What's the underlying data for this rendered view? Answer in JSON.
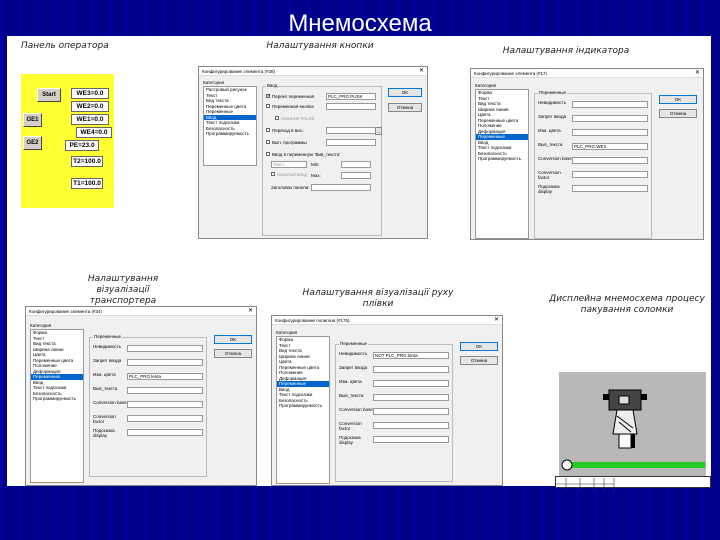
{
  "slide": {
    "title": "Мнемосхема",
    "background_color": "#00008b"
  },
  "captions": {
    "operator_panel": "Панель оператора",
    "button_setup": "Налаштування кнопки",
    "indicator_setup": "Налаштування індикатора",
    "conveyor_viz_line1": "Налаштування",
    "conveyor_viz_line2": "візуалізації транспортера",
    "film_viz": "Налаштування візуалізації руху плівки",
    "display_line1": "Дисплейна мнемосхема процесу",
    "display_line2": "пакування соломки"
  },
  "operator_panel": {
    "color": "#ffff33",
    "start_label": "Start",
    "ge1_label": "GE1",
    "ge2_label": "GE2",
    "we3": "WE3=0.0",
    "we2": "WE2=0.0",
    "we1": "WE1=0.0",
    "we4": "WE4=0.0",
    "pe": "PE=23.0",
    "t2": "T2=100.0",
    "t1": "T1=100.0"
  },
  "dialog_button": {
    "title": "Конфигурирование элемента (#38)",
    "category_label": "Категория",
    "categories": [
      "Растровый рисунок",
      "Текст",
      "Вид текста",
      "Переменные цвета",
      "Переменные",
      "Ввод",
      "Текст подсказки",
      "Безопасность",
      "Программируемость"
    ],
    "selected_index": 5,
    "group_label": "Ввод",
    "toggle_var_label": "Перекл переменная",
    "toggle_var_value": "PLC_PRG.PUSK",
    "toggle_var_checked": true,
    "button_var_label": "Переменная-кнопка",
    "push_false_label": "Нажатие FALSE",
    "goto_label": "Переход в виз.:",
    "run_program_label": "Вып. программы",
    "input_var_label": "Ввод в переменную 'Вив_текста'",
    "text_label": "Текст",
    "min_label": "Min:",
    "max_label": "Max:",
    "hidden_input_label": "Скрытый ввод",
    "dialog_title_label": "Заголовок панели:",
    "ok_label": "OK",
    "cancel_label": "Отмена"
  },
  "dialog_indicator": {
    "title": "Конфигурирование элемента (#17)",
    "category_label": "Категория",
    "categories": [
      "Форма",
      "Текст",
      "Вид текста",
      "Ширина линии",
      "Цвета",
      "Переменные цвета",
      "Положение",
      "Деформация",
      "Переменные",
      "Ввод",
      "Текст подсказки",
      "Безопасность",
      "Программируемость"
    ],
    "selected_index": 8,
    "group_label": "Переменные",
    "rows": [
      {
        "label": "Невидимость",
        "value": ""
      },
      {
        "label": "Запрет ввода",
        "value": ""
      },
      {
        "label": "Изм. цвета",
        "value": ""
      },
      {
        "label": "Выв_текста",
        "value": "PLC_PRG.WE3"
      },
      {
        "label": "Conversion base",
        "value": ""
      },
      {
        "label": "Conversion factor",
        "value": ""
      },
      {
        "label": "Подсказка display",
        "value": ""
      }
    ],
    "ok_label": "OK",
    "cancel_label": "Отмена"
  },
  "dialog_conveyor": {
    "title": "Конфигурирование элемента (#34)",
    "category_label": "Категория",
    "categories": [
      "Форма",
      "Текст",
      "Вид текста",
      "Ширина линии",
      "Цвета",
      "Переменные цвета",
      "Положение",
      "Деформация",
      "Переменные",
      "Ввод",
      "Текст подсказки",
      "Безопасность",
      "Программируемость"
    ],
    "selected_index": 8,
    "group_label": "Переменные",
    "rows": [
      {
        "label": "Невидимость",
        "value": ""
      },
      {
        "label": "Запрет ввода",
        "value": ""
      },
      {
        "label": "Изм. цвета",
        "value": "PLC_PRG.lenta"
      },
      {
        "label": "Выв_текста",
        "value": ""
      },
      {
        "label": "Conversion base",
        "value": ""
      },
      {
        "label": "Conversion factor",
        "value": ""
      },
      {
        "label": "Подсказка display",
        "value": ""
      }
    ],
    "ok_label": "OK",
    "cancel_label": "Отмена"
  },
  "dialog_film": {
    "title": "Конфигурирование полигона (#175)",
    "category_label": "Категория",
    "categories": [
      "Форма",
      "Текст",
      "Вид текста",
      "Ширина линии",
      "Цвета",
      "Переменные цвета",
      "Положение",
      "Деформация",
      "Переменные",
      "Ввод",
      "Текст подсказки",
      "Безопасность",
      "Программируемость"
    ],
    "selected_index": 8,
    "group_label": "Переменные",
    "rows": [
      {
        "label": "Невидимость",
        "value": "NOT PLC_PRG.lenta"
      },
      {
        "label": "Запрет ввода",
        "value": ""
      },
      {
        "label": "Изм. цвета",
        "value": ""
      },
      {
        "label": "Выв_текста",
        "value": ""
      },
      {
        "label": "Conversion base",
        "value": ""
      },
      {
        "label": "Conversion factor",
        "value": ""
      },
      {
        "label": "Подсказка display",
        "value": ""
      }
    ],
    "ok_label": "OK",
    "cancel_label": "Отмена"
  },
  "mnemo": {
    "background_color": "#b8b8b8",
    "belt_color": "#22cc22"
  }
}
